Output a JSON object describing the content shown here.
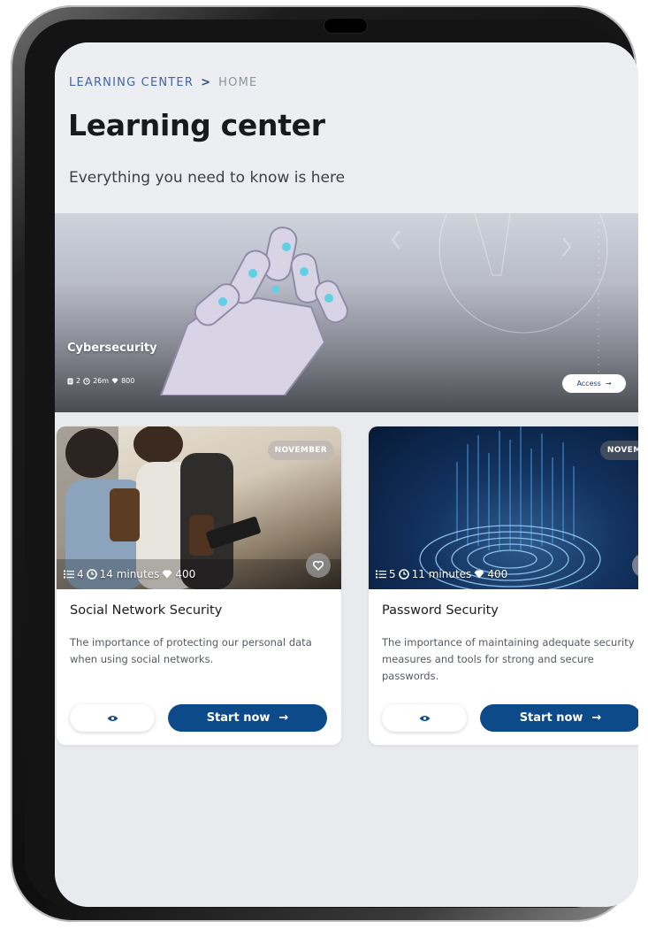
{
  "breadcrumb": {
    "root": "LEARNING CENTER",
    "separator": ">",
    "current": "HOME"
  },
  "page": {
    "title": "Learning center",
    "subtitle": "Everything you need to know is here"
  },
  "hero": {
    "title": "Cybersecurity",
    "lessons": "2",
    "duration": "26m",
    "points": "800",
    "access_label": "Access",
    "access_arrow": "→"
  },
  "cards": [
    {
      "badge": "NOVEMBER",
      "lessons": "4",
      "duration": "14 minutes",
      "points": "400",
      "title": "Social Network Security",
      "description": "The importance of protecting our personal data when using social networks.",
      "start_label": "Start now",
      "start_arrow": "→"
    },
    {
      "badge": "NOVEMBE",
      "lessons": "5",
      "duration": "11 minutes",
      "points": "400",
      "title": "Password Security",
      "description": "The importance of maintaining adequate security measures and tools for strong and secure passwords.",
      "start_label": "Start now",
      "start_arrow": "→"
    }
  ],
  "colors": {
    "accent": "#0d4a8a",
    "breadcrumb": "#3f66a8",
    "background": "#e8eaed"
  }
}
